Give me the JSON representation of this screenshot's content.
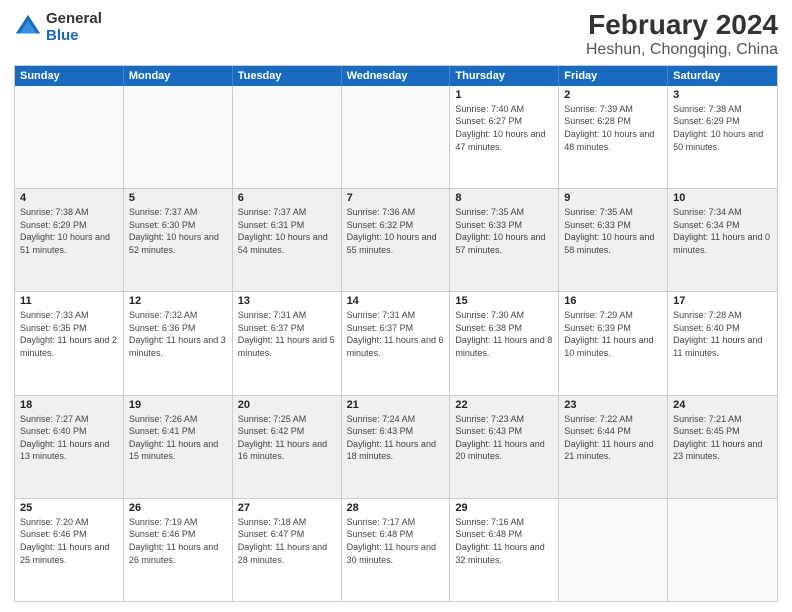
{
  "logo": {
    "line1": "General",
    "line2": "Blue"
  },
  "title": "February 2024",
  "subtitle": "Heshun, Chongqing, China",
  "header_days": [
    "Sunday",
    "Monday",
    "Tuesday",
    "Wednesday",
    "Thursday",
    "Friday",
    "Saturday"
  ],
  "weeks": [
    [
      {
        "day": "",
        "sunrise": "",
        "sunset": "",
        "daylight": "",
        "empty": true
      },
      {
        "day": "",
        "sunrise": "",
        "sunset": "",
        "daylight": "",
        "empty": true
      },
      {
        "day": "",
        "sunrise": "",
        "sunset": "",
        "daylight": "",
        "empty": true
      },
      {
        "day": "",
        "sunrise": "",
        "sunset": "",
        "daylight": "",
        "empty": true
      },
      {
        "day": "1",
        "sunrise": "Sunrise: 7:40 AM",
        "sunset": "Sunset: 6:27 PM",
        "daylight": "Daylight: 10 hours and 47 minutes."
      },
      {
        "day": "2",
        "sunrise": "Sunrise: 7:39 AM",
        "sunset": "Sunset: 6:28 PM",
        "daylight": "Daylight: 10 hours and 48 minutes."
      },
      {
        "day": "3",
        "sunrise": "Sunrise: 7:38 AM",
        "sunset": "Sunset: 6:29 PM",
        "daylight": "Daylight: 10 hours and 50 minutes."
      }
    ],
    [
      {
        "day": "4",
        "sunrise": "Sunrise: 7:38 AM",
        "sunset": "Sunset: 6:29 PM",
        "daylight": "Daylight: 10 hours and 51 minutes."
      },
      {
        "day": "5",
        "sunrise": "Sunrise: 7:37 AM",
        "sunset": "Sunset: 6:30 PM",
        "daylight": "Daylight: 10 hours and 52 minutes."
      },
      {
        "day": "6",
        "sunrise": "Sunrise: 7:37 AM",
        "sunset": "Sunset: 6:31 PM",
        "daylight": "Daylight: 10 hours and 54 minutes."
      },
      {
        "day": "7",
        "sunrise": "Sunrise: 7:36 AM",
        "sunset": "Sunset: 6:32 PM",
        "daylight": "Daylight: 10 hours and 55 minutes."
      },
      {
        "day": "8",
        "sunrise": "Sunrise: 7:35 AM",
        "sunset": "Sunset: 6:33 PM",
        "daylight": "Daylight: 10 hours and 57 minutes."
      },
      {
        "day": "9",
        "sunrise": "Sunrise: 7:35 AM",
        "sunset": "Sunset: 6:33 PM",
        "daylight": "Daylight: 10 hours and 58 minutes."
      },
      {
        "day": "10",
        "sunrise": "Sunrise: 7:34 AM",
        "sunset": "Sunset: 6:34 PM",
        "daylight": "Daylight: 11 hours and 0 minutes."
      }
    ],
    [
      {
        "day": "11",
        "sunrise": "Sunrise: 7:33 AM",
        "sunset": "Sunset: 6:35 PM",
        "daylight": "Daylight: 11 hours and 2 minutes."
      },
      {
        "day": "12",
        "sunrise": "Sunrise: 7:32 AM",
        "sunset": "Sunset: 6:36 PM",
        "daylight": "Daylight: 11 hours and 3 minutes."
      },
      {
        "day": "13",
        "sunrise": "Sunrise: 7:31 AM",
        "sunset": "Sunset: 6:37 PM",
        "daylight": "Daylight: 11 hours and 5 minutes."
      },
      {
        "day": "14",
        "sunrise": "Sunrise: 7:31 AM",
        "sunset": "Sunset: 6:37 PM",
        "daylight": "Daylight: 11 hours and 6 minutes."
      },
      {
        "day": "15",
        "sunrise": "Sunrise: 7:30 AM",
        "sunset": "Sunset: 6:38 PM",
        "daylight": "Daylight: 11 hours and 8 minutes."
      },
      {
        "day": "16",
        "sunrise": "Sunrise: 7:29 AM",
        "sunset": "Sunset: 6:39 PM",
        "daylight": "Daylight: 11 hours and 10 minutes."
      },
      {
        "day": "17",
        "sunrise": "Sunrise: 7:28 AM",
        "sunset": "Sunset: 6:40 PM",
        "daylight": "Daylight: 11 hours and 11 minutes."
      }
    ],
    [
      {
        "day": "18",
        "sunrise": "Sunrise: 7:27 AM",
        "sunset": "Sunset: 6:40 PM",
        "daylight": "Daylight: 11 hours and 13 minutes."
      },
      {
        "day": "19",
        "sunrise": "Sunrise: 7:26 AM",
        "sunset": "Sunset: 6:41 PM",
        "daylight": "Daylight: 11 hours and 15 minutes."
      },
      {
        "day": "20",
        "sunrise": "Sunrise: 7:25 AM",
        "sunset": "Sunset: 6:42 PM",
        "daylight": "Daylight: 11 hours and 16 minutes."
      },
      {
        "day": "21",
        "sunrise": "Sunrise: 7:24 AM",
        "sunset": "Sunset: 6:43 PM",
        "daylight": "Daylight: 11 hours and 18 minutes."
      },
      {
        "day": "22",
        "sunrise": "Sunrise: 7:23 AM",
        "sunset": "Sunset: 6:43 PM",
        "daylight": "Daylight: 11 hours and 20 minutes."
      },
      {
        "day": "23",
        "sunrise": "Sunrise: 7:22 AM",
        "sunset": "Sunset: 6:44 PM",
        "daylight": "Daylight: 11 hours and 21 minutes."
      },
      {
        "day": "24",
        "sunrise": "Sunrise: 7:21 AM",
        "sunset": "Sunset: 6:45 PM",
        "daylight": "Daylight: 11 hours and 23 minutes."
      }
    ],
    [
      {
        "day": "25",
        "sunrise": "Sunrise: 7:20 AM",
        "sunset": "Sunset: 6:46 PM",
        "daylight": "Daylight: 11 hours and 25 minutes."
      },
      {
        "day": "26",
        "sunrise": "Sunrise: 7:19 AM",
        "sunset": "Sunset: 6:46 PM",
        "daylight": "Daylight: 11 hours and 26 minutes."
      },
      {
        "day": "27",
        "sunrise": "Sunrise: 7:18 AM",
        "sunset": "Sunset: 6:47 PM",
        "daylight": "Daylight: 11 hours and 28 minutes."
      },
      {
        "day": "28",
        "sunrise": "Sunrise: 7:17 AM",
        "sunset": "Sunset: 6:48 PM",
        "daylight": "Daylight: 11 hours and 30 minutes."
      },
      {
        "day": "29",
        "sunrise": "Sunrise: 7:16 AM",
        "sunset": "Sunset: 6:48 PM",
        "daylight": "Daylight: 11 hours and 32 minutes."
      },
      {
        "day": "",
        "sunrise": "",
        "sunset": "",
        "daylight": "",
        "empty": true
      },
      {
        "day": "",
        "sunrise": "",
        "sunset": "",
        "daylight": "",
        "empty": true
      }
    ]
  ]
}
